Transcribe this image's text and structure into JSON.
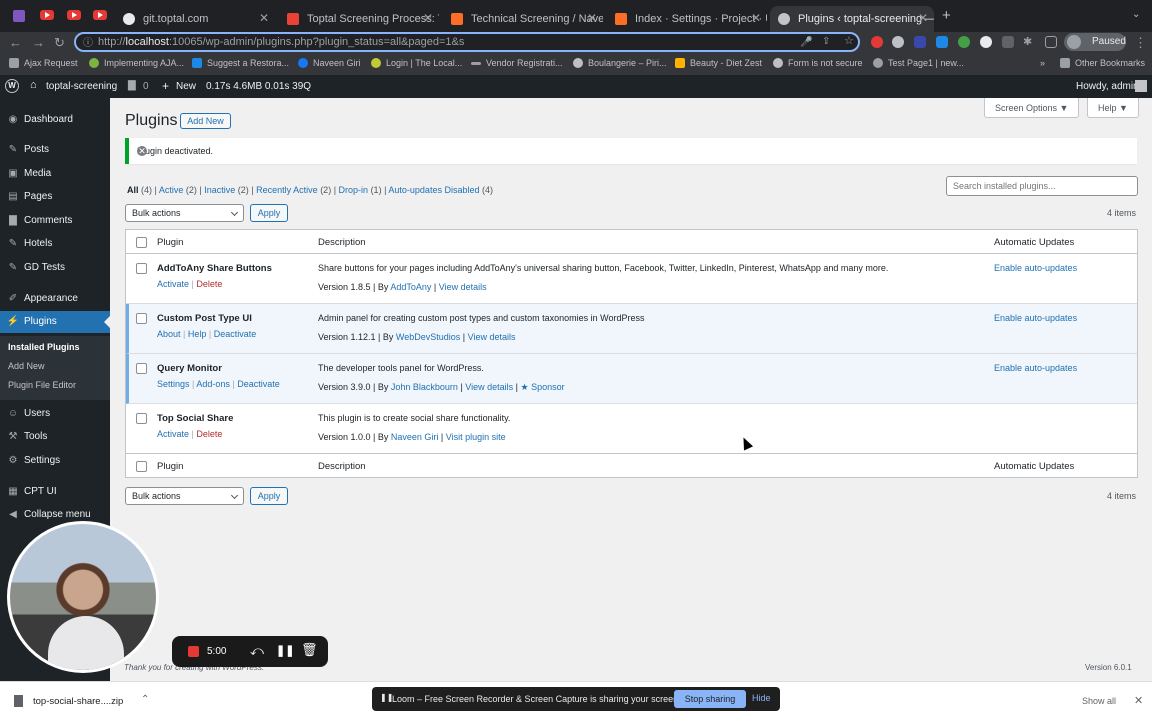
{
  "browser": {
    "tabs": [
      {
        "title": "git.toptal.com"
      },
      {
        "title": "Toptal Screening Process: Tes"
      },
      {
        "title": "Technical Screening / Naveen-"
      },
      {
        "title": "Index · Settings · Project · Use"
      },
      {
        "title": "Plugins ‹ toptal-screening — W"
      }
    ],
    "url_prefix": "http://",
    "url_host": "localhost",
    "url_rest": ":10065/wp-admin/plugins.php?plugin_status=all&paged=1&s",
    "profile_status": "Paused",
    "bookmarks": [
      "Ajax Request",
      "Implementing AJA...",
      "Suggest a Restora...",
      "Naveen Giri",
      "Login | The Local...",
      "Vendor Registrati...",
      "Boulangerie – Piri...",
      "Beauty - Diet Zest",
      "Form is not secure",
      "Test Page1 | new..."
    ],
    "other_bookmarks": "Other Bookmarks",
    "colors": {
      "tabbar": "#202124",
      "toolbar": "#35363a",
      "omnibox_focus": "#8ab4f8"
    }
  },
  "adminbar": {
    "site": "toptal-screening",
    "comments": "0",
    "new": "New",
    "stats": "0.17s  4.6MB  0.01s  39Q",
    "howdy": "Howdy, admin"
  },
  "sidebar": {
    "items": [
      {
        "label": "Dashboard",
        "icon": "dashboard-icon"
      },
      {
        "label": "Posts",
        "icon": "pin-icon"
      },
      {
        "label": "Media",
        "icon": "media-icon"
      },
      {
        "label": "Pages",
        "icon": "page-icon"
      },
      {
        "label": "Comments",
        "icon": "comment-icon"
      },
      {
        "label": "Hotels",
        "icon": "pin-icon"
      },
      {
        "label": "GD Tests",
        "icon": "pin-icon"
      },
      {
        "label": "Appearance",
        "icon": "brush-icon"
      },
      {
        "label": "Plugins",
        "icon": "plugin-icon"
      },
      {
        "label": "Users",
        "icon": "user-icon"
      },
      {
        "label": "Tools",
        "icon": "wrench-icon"
      },
      {
        "label": "Settings",
        "icon": "settings-icon"
      },
      {
        "label": "CPT UI",
        "icon": "cpt-icon"
      },
      {
        "label": "Collapse menu",
        "icon": "collapse-icon"
      }
    ],
    "submenu": [
      "Installed Plugins",
      "Add New",
      "Plugin File Editor"
    ],
    "accent": "#2271b1"
  },
  "page": {
    "title": "Plugins",
    "add_new": "Add New",
    "screen_options": "Screen Options ▼",
    "help": "Help ▼",
    "notice": "Plugin deactivated.",
    "filters": {
      "all": "All",
      "all_count": "(4)",
      "active": "Active",
      "active_count": "(2)",
      "inactive": "Inactive",
      "inactive_count": "(2)",
      "recent": "Recently Active",
      "recent_count": "(2)",
      "dropin": "Drop-in",
      "dropin_count": "(1)",
      "autodis": "Auto-updates Disabled",
      "autodis_count": "(4)"
    },
    "search_placeholder": "Search installed plugins...",
    "bulk_actions": "Bulk actions",
    "apply": "Apply",
    "items_count": "4 items",
    "columns": {
      "plugin": "Plugin",
      "description": "Description",
      "auto": "Automatic Updates"
    },
    "plugins": [
      {
        "name": "AddToAny Share Buttons",
        "actions": [
          "Activate",
          "Delete"
        ],
        "description": "Share buttons for your pages including AddToAny's universal sharing button, Facebook, Twitter, LinkedIn, Pinterest, WhatsApp and many more.",
        "version": "Version 1.8.5 | By ",
        "author": "AddToAny",
        "link": "View details",
        "auto": "Enable auto-updates",
        "active": false
      },
      {
        "name": "Custom Post Type UI",
        "actions": [
          "About",
          "Help",
          "Deactivate"
        ],
        "description": "Admin panel for creating custom post types and custom taxonomies in WordPress",
        "version": "Version 1.12.1 | By ",
        "author": "WebDevStudios",
        "link": "View details",
        "auto": "Enable auto-updates",
        "active": true
      },
      {
        "name": "Query Monitor",
        "actions": [
          "Settings",
          "Add-ons",
          "Deactivate"
        ],
        "description": "The developer tools panel for WordPress.",
        "version": "Version 3.9.0 | By ",
        "author": "John Blackbourn",
        "link": "View details",
        "extra": "★ Sponsor",
        "auto": "Enable auto-updates",
        "active": true
      },
      {
        "name": "Top Social Share",
        "actions": [
          "Activate",
          "Delete"
        ],
        "description": "This plugin is to create social share functionality.",
        "version": "Version 1.0.0 | By ",
        "author": "Naveen Giri",
        "link": "Visit plugin site",
        "auto": "",
        "active": false
      }
    ],
    "footer": "Thank you for creating with WordPress.",
    "version": "Version 6.0.1"
  },
  "recorder": {
    "time": "5:00"
  },
  "loom": {
    "message": "Loom – Free Screen Recorder & Screen Capture is sharing your screen.",
    "stop": "Stop sharing",
    "hide": "Hide"
  },
  "download": {
    "file": "top-social-share....zip",
    "show_all": "Show all"
  }
}
